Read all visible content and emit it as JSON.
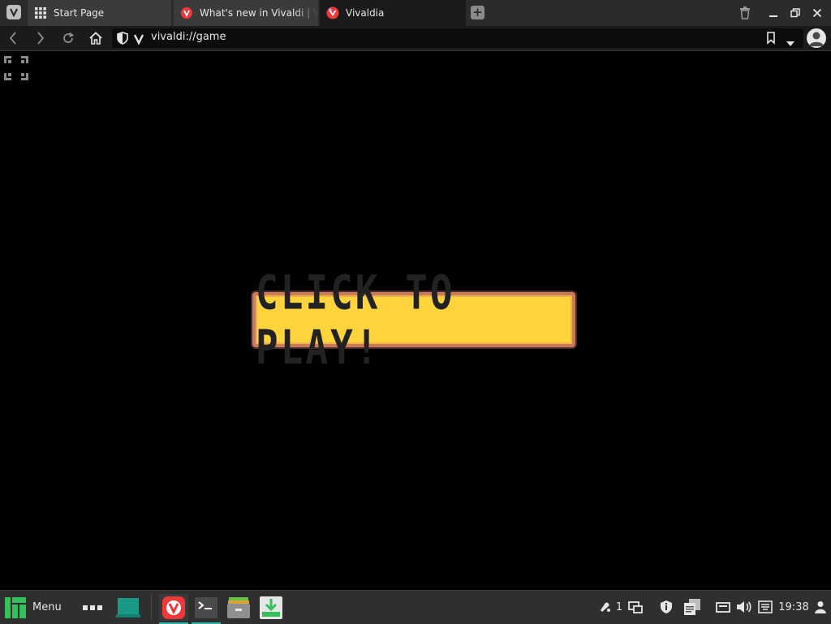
{
  "browser": {
    "tabs": [
      {
        "label": "Start Page",
        "icon": "grid-icon"
      },
      {
        "label": "What's new in Vivaldi | Vival",
        "icon": "vivaldi-icon"
      },
      {
        "label": "Vivaldia",
        "icon": "vivaldia-icon",
        "active": true
      }
    ],
    "url": "vivaldi://game"
  },
  "game": {
    "play_label": "CLICK TO PLAY!",
    "colors": {
      "button": "#ffd33c",
      "border": "#c97b5a"
    }
  },
  "taskbar": {
    "menu_label": "Menu",
    "notifications_count": "1",
    "clock": "19:38"
  }
}
